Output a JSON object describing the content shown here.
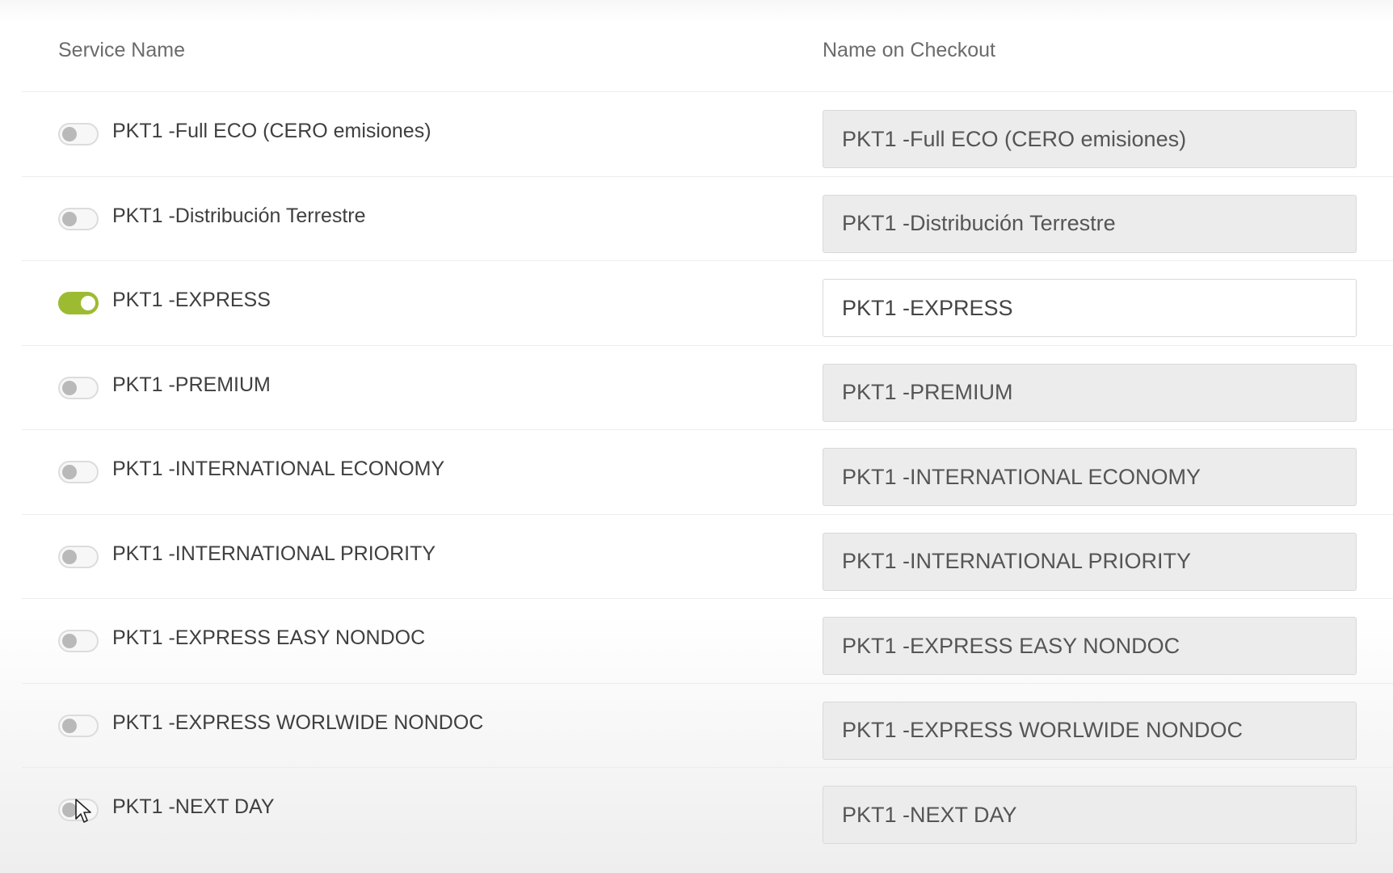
{
  "header": {
    "service_name": "Service Name",
    "name_on_checkout": "Name on Checkout"
  },
  "rows": [
    {
      "service": "PKT1 -Full ECO (CERO emisiones)",
      "checkout": "PKT1 -Full ECO (CERO emisiones)",
      "enabled": false
    },
    {
      "service": "PKT1 -Distribución Terrestre",
      "checkout": "PKT1 -Distribución Terrestre",
      "enabled": false
    },
    {
      "service": "PKT1 -EXPRESS",
      "checkout": "PKT1 -EXPRESS",
      "enabled": true
    },
    {
      "service": "PKT1 -PREMIUM",
      "checkout": "PKT1 -PREMIUM",
      "enabled": false
    },
    {
      "service": "PKT1 -INTERNATIONAL ECONOMY",
      "checkout": "PKT1 -INTERNATIONAL ECONOMY",
      "enabled": false
    },
    {
      "service": "PKT1 -INTERNATIONAL PRIORITY",
      "checkout": "PKT1 -INTERNATIONAL PRIORITY",
      "enabled": false
    },
    {
      "service": "PKT1 -EXPRESS EASY NONDOC",
      "checkout": "PKT1 -EXPRESS EASY NONDOC",
      "enabled": false
    },
    {
      "service": "PKT1 -EXPRESS WORLWIDE NONDOC",
      "checkout": "PKT1 -EXPRESS WORLWIDE NONDOC",
      "enabled": false
    },
    {
      "service": "PKT1 -NEXT DAY",
      "checkout": "PKT1 -NEXT DAY",
      "enabled": false
    }
  ],
  "colors": {
    "toggle_on": "#9dbb31",
    "toggle_off": "#b9b9b9",
    "input_disabled_bg": "#ececec",
    "input_enabled_bg": "#ffffff"
  },
  "icons": {
    "cursor": "mouse-pointer-icon"
  }
}
